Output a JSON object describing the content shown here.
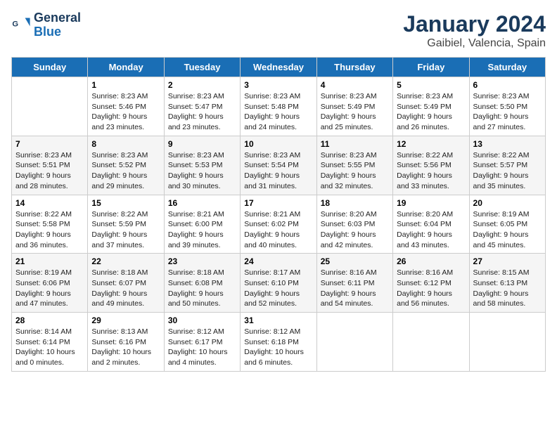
{
  "header": {
    "logo_line1": "General",
    "logo_line2": "Blue",
    "title": "January 2024",
    "subtitle": "Gaibiel, Valencia, Spain"
  },
  "calendar": {
    "days_of_week": [
      "Sunday",
      "Monday",
      "Tuesday",
      "Wednesday",
      "Thursday",
      "Friday",
      "Saturday"
    ],
    "weeks": [
      [
        {
          "num": "",
          "sunrise": "",
          "sunset": "",
          "daylight": ""
        },
        {
          "num": "1",
          "sunrise": "Sunrise: 8:23 AM",
          "sunset": "Sunset: 5:46 PM",
          "daylight": "Daylight: 9 hours and 23 minutes."
        },
        {
          "num": "2",
          "sunrise": "Sunrise: 8:23 AM",
          "sunset": "Sunset: 5:47 PM",
          "daylight": "Daylight: 9 hours and 23 minutes."
        },
        {
          "num": "3",
          "sunrise": "Sunrise: 8:23 AM",
          "sunset": "Sunset: 5:48 PM",
          "daylight": "Daylight: 9 hours and 24 minutes."
        },
        {
          "num": "4",
          "sunrise": "Sunrise: 8:23 AM",
          "sunset": "Sunset: 5:49 PM",
          "daylight": "Daylight: 9 hours and 25 minutes."
        },
        {
          "num": "5",
          "sunrise": "Sunrise: 8:23 AM",
          "sunset": "Sunset: 5:49 PM",
          "daylight": "Daylight: 9 hours and 26 minutes."
        },
        {
          "num": "6",
          "sunrise": "Sunrise: 8:23 AM",
          "sunset": "Sunset: 5:50 PM",
          "daylight": "Daylight: 9 hours and 27 minutes."
        }
      ],
      [
        {
          "num": "7",
          "sunrise": "Sunrise: 8:23 AM",
          "sunset": "Sunset: 5:51 PM",
          "daylight": "Daylight: 9 hours and 28 minutes."
        },
        {
          "num": "8",
          "sunrise": "Sunrise: 8:23 AM",
          "sunset": "Sunset: 5:52 PM",
          "daylight": "Daylight: 9 hours and 29 minutes."
        },
        {
          "num": "9",
          "sunrise": "Sunrise: 8:23 AM",
          "sunset": "Sunset: 5:53 PM",
          "daylight": "Daylight: 9 hours and 30 minutes."
        },
        {
          "num": "10",
          "sunrise": "Sunrise: 8:23 AM",
          "sunset": "Sunset: 5:54 PM",
          "daylight": "Daylight: 9 hours and 31 minutes."
        },
        {
          "num": "11",
          "sunrise": "Sunrise: 8:23 AM",
          "sunset": "Sunset: 5:55 PM",
          "daylight": "Daylight: 9 hours and 32 minutes."
        },
        {
          "num": "12",
          "sunrise": "Sunrise: 8:22 AM",
          "sunset": "Sunset: 5:56 PM",
          "daylight": "Daylight: 9 hours and 33 minutes."
        },
        {
          "num": "13",
          "sunrise": "Sunrise: 8:22 AM",
          "sunset": "Sunset: 5:57 PM",
          "daylight": "Daylight: 9 hours and 35 minutes."
        }
      ],
      [
        {
          "num": "14",
          "sunrise": "Sunrise: 8:22 AM",
          "sunset": "Sunset: 5:58 PM",
          "daylight": "Daylight: 9 hours and 36 minutes."
        },
        {
          "num": "15",
          "sunrise": "Sunrise: 8:22 AM",
          "sunset": "Sunset: 5:59 PM",
          "daylight": "Daylight: 9 hours and 37 minutes."
        },
        {
          "num": "16",
          "sunrise": "Sunrise: 8:21 AM",
          "sunset": "Sunset: 6:00 PM",
          "daylight": "Daylight: 9 hours and 39 minutes."
        },
        {
          "num": "17",
          "sunrise": "Sunrise: 8:21 AM",
          "sunset": "Sunset: 6:02 PM",
          "daylight": "Daylight: 9 hours and 40 minutes."
        },
        {
          "num": "18",
          "sunrise": "Sunrise: 8:20 AM",
          "sunset": "Sunset: 6:03 PM",
          "daylight": "Daylight: 9 hours and 42 minutes."
        },
        {
          "num": "19",
          "sunrise": "Sunrise: 8:20 AM",
          "sunset": "Sunset: 6:04 PM",
          "daylight": "Daylight: 9 hours and 43 minutes."
        },
        {
          "num": "20",
          "sunrise": "Sunrise: 8:19 AM",
          "sunset": "Sunset: 6:05 PM",
          "daylight": "Daylight: 9 hours and 45 minutes."
        }
      ],
      [
        {
          "num": "21",
          "sunrise": "Sunrise: 8:19 AM",
          "sunset": "Sunset: 6:06 PM",
          "daylight": "Daylight: 9 hours and 47 minutes."
        },
        {
          "num": "22",
          "sunrise": "Sunrise: 8:18 AM",
          "sunset": "Sunset: 6:07 PM",
          "daylight": "Daylight: 9 hours and 49 minutes."
        },
        {
          "num": "23",
          "sunrise": "Sunrise: 8:18 AM",
          "sunset": "Sunset: 6:08 PM",
          "daylight": "Daylight: 9 hours and 50 minutes."
        },
        {
          "num": "24",
          "sunrise": "Sunrise: 8:17 AM",
          "sunset": "Sunset: 6:10 PM",
          "daylight": "Daylight: 9 hours and 52 minutes."
        },
        {
          "num": "25",
          "sunrise": "Sunrise: 8:16 AM",
          "sunset": "Sunset: 6:11 PM",
          "daylight": "Daylight: 9 hours and 54 minutes."
        },
        {
          "num": "26",
          "sunrise": "Sunrise: 8:16 AM",
          "sunset": "Sunset: 6:12 PM",
          "daylight": "Daylight: 9 hours and 56 minutes."
        },
        {
          "num": "27",
          "sunrise": "Sunrise: 8:15 AM",
          "sunset": "Sunset: 6:13 PM",
          "daylight": "Daylight: 9 hours and 58 minutes."
        }
      ],
      [
        {
          "num": "28",
          "sunrise": "Sunrise: 8:14 AM",
          "sunset": "Sunset: 6:14 PM",
          "daylight": "Daylight: 10 hours and 0 minutes."
        },
        {
          "num": "29",
          "sunrise": "Sunrise: 8:13 AM",
          "sunset": "Sunset: 6:16 PM",
          "daylight": "Daylight: 10 hours and 2 minutes."
        },
        {
          "num": "30",
          "sunrise": "Sunrise: 8:12 AM",
          "sunset": "Sunset: 6:17 PM",
          "daylight": "Daylight: 10 hours and 4 minutes."
        },
        {
          "num": "31",
          "sunrise": "Sunrise: 8:12 AM",
          "sunset": "Sunset: 6:18 PM",
          "daylight": "Daylight: 10 hours and 6 minutes."
        },
        {
          "num": "",
          "sunrise": "",
          "sunset": "",
          "daylight": ""
        },
        {
          "num": "",
          "sunrise": "",
          "sunset": "",
          "daylight": ""
        },
        {
          "num": "",
          "sunrise": "",
          "sunset": "",
          "daylight": ""
        }
      ]
    ]
  }
}
